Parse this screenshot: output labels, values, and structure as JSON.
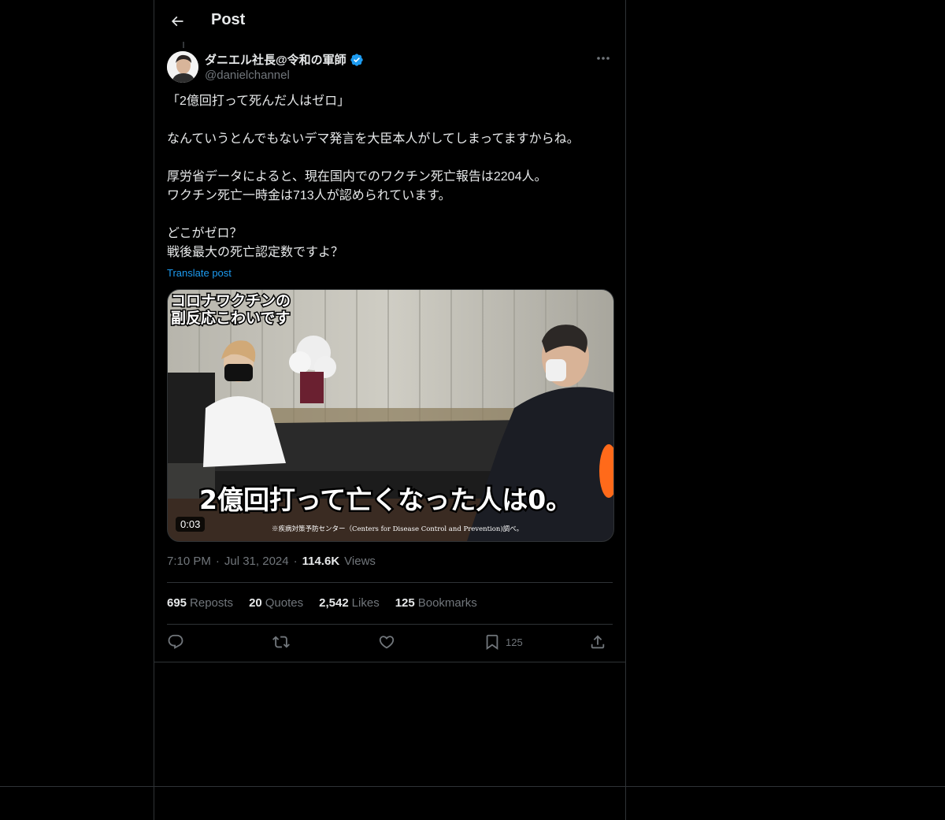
{
  "header": {
    "title": "Post"
  },
  "author": {
    "name": "ダニエル社長@令和の軍師",
    "handle": "@danielchannel",
    "verified_color": "#1d9bf0"
  },
  "post": {
    "lines": [
      "「2億回打って死んだ人はゼロ」",
      "",
      "なんていうとんでもないデマ発言を大臣本人がしてしまってますからね。",
      "",
      "厚労省データによると、現在国内でのワクチン死亡報告は2204人。",
      "ワクチン死亡一時金は713人が認められています。",
      "",
      "どこがゼロ？",
      "戦後最大の死亡認定数ですよ？"
    ],
    "translate_label": "Translate post"
  },
  "media": {
    "caption_top_1": "コロナワクチンの",
    "caption_top_2": "副反応こわいです",
    "subtitle": "2億回打って亡くなった人は0。",
    "footnote": "※疾病対策予防センター（Centers for Disease Control and Prevention)調べ。",
    "duration": "0:03"
  },
  "meta": {
    "time": "7:10 PM",
    "sep1": "·",
    "date": "Jul 31, 2024",
    "sep2": "·",
    "views_count": "114.6K",
    "views_label": "Views"
  },
  "stats": [
    {
      "count": "695",
      "label": "Reposts"
    },
    {
      "count": "20",
      "label": "Quotes"
    },
    {
      "count": "2,542",
      "label": "Likes"
    },
    {
      "count": "125",
      "label": "Bookmarks"
    }
  ],
  "actions": {
    "reply_icon": "reply-icon",
    "repost_icon": "repost-icon",
    "like_icon": "heart-icon",
    "bookmark_icon": "bookmark-icon",
    "bookmark_count": "125",
    "share_icon": "share-icon"
  }
}
